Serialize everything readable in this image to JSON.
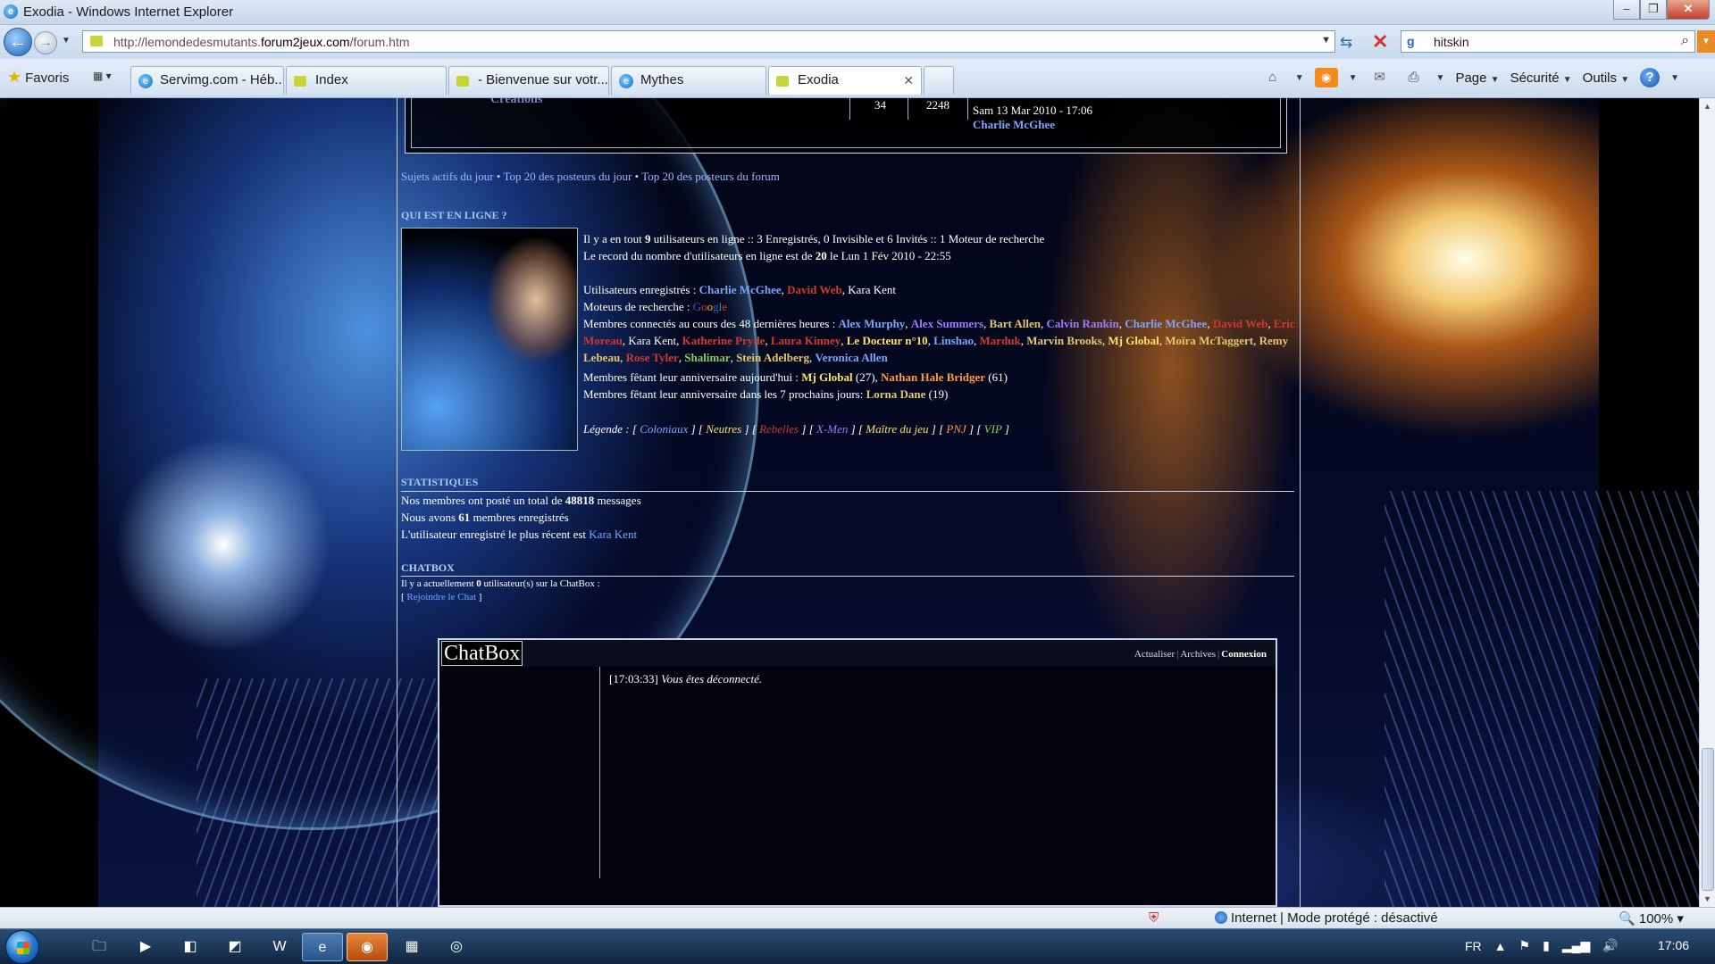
{
  "window": {
    "title": "Exodia - Windows Internet Explorer"
  },
  "nav": {
    "url_prefix": "http://lemondedesmutants.",
    "url_domain": "forum2jeux.com",
    "url_suffix": "/forum.htm",
    "search_value": "hitskin"
  },
  "tabs": {
    "favorites_label": "Favoris",
    "items": [
      {
        "label": "Servimg.com - Héb...",
        "icon": "ie-icon"
      },
      {
        "label": "Index",
        "icon": "forum-icon"
      },
      {
        "label": "- Bienvenue sur votr...",
        "icon": "forum-icon"
      },
      {
        "label": "Mythes",
        "icon": "ie-icon"
      },
      {
        "label": "Exodia",
        "icon": "forum-icon",
        "active": true
      }
    ]
  },
  "commandbar": {
    "page": "Page",
    "security": "Sécurité",
    "tools": "Outils"
  },
  "forum_box": {
    "link": "Créations",
    "topics": "34",
    "posts": "2248",
    "last_date": "Sam 13 Mar 2010 - 17:06",
    "last_author": "Charlie McGhee"
  },
  "active_links": {
    "l1": "Sujets actifs du jour",
    "l2": "Top 20 des posteurs du jour",
    "l3": "Top 20 des posteurs du forum",
    "sep": "•"
  },
  "online": {
    "title": "QUI EST EN LIGNE ?",
    "line1_a": "Il y a en tout ",
    "line1_n": "9",
    "line1_b": " utilisateurs en ligne :: 3 Enregistrés, 0 Invisible et 6 Invités :: 1 Moteur de recherche",
    "line2_a": "Le record du nombre d'utilisateurs en ligne est de ",
    "line2_n": "20",
    "line2_b": " le Lun 1 Fév 2010 - 22:55",
    "registered_label": "Utilisateurs enregistrés : ",
    "reg1": "Charlie McGhee",
    "reg2": "David Web",
    "reg3": "Kara Kent",
    "engines_label": "Moteurs de recherche : ",
    "google": [
      "G",
      "o",
      "o",
      "g",
      "l",
      "e"
    ],
    "recent_label": "Membres connectés au cours des 48 dernières heures : ",
    "recent": [
      {
        "name": "Alex Murphy",
        "cls": "u-blue"
      },
      {
        "name": "Alex Summers",
        "cls": "u-purple"
      },
      {
        "name": "Bart Allen",
        "cls": "u-gold"
      },
      {
        "name": "Calvin Rankin",
        "cls": "u-purple"
      },
      {
        "name": "Charlie McGhee",
        "cls": "u-blue"
      },
      {
        "name": "David Web",
        "cls": "u-red"
      },
      {
        "name": "Eric Moreau",
        "cls": "u-red"
      },
      {
        "name": "Kara Kent",
        "cls": "u-plain"
      },
      {
        "name": "Katherine Pryde",
        "cls": "u-red"
      },
      {
        "name": "Laura Kinney",
        "cls": "u-red"
      },
      {
        "name": "Le Docteur n°10",
        "cls": "u-yellow"
      },
      {
        "name": "Linshao",
        "cls": "u-blue"
      },
      {
        "name": "Marduk",
        "cls": "u-red"
      },
      {
        "name": "Marvin Brooks",
        "cls": "u-gold"
      },
      {
        "name": "Mj Global",
        "cls": "u-yellow"
      },
      {
        "name": "Moïra McTaggert",
        "cls": "u-gold"
      },
      {
        "name": "Remy Lebeau",
        "cls": "u-gold"
      },
      {
        "name": "Rose Tyler",
        "cls": "u-red"
      },
      {
        "name": "Shalimar",
        "cls": "u-green"
      },
      {
        "name": "Stein Adelberg",
        "cls": "u-gold"
      },
      {
        "name": "Veronica Allen",
        "cls": "u-blue"
      }
    ],
    "bday_today_label": "Membres fêtant leur anniversaire aujourd'hui : ",
    "bday_today_1": "Mj Global",
    "bday_today_1_age": " (27), ",
    "bday_today_2": "Nathan Hale Bridger",
    "bday_today_2_age": " (61)",
    "bday_week_label": "Membres fêtant leur anniversaire dans les 7 prochains jours: ",
    "bday_week_1": "Lorna Dane",
    "bday_week_1_age": " (19)",
    "legend_label": "Légende : ",
    "legend": [
      {
        "name": "Coloniaux",
        "color": "#7aa6ff"
      },
      {
        "name": "Neutres",
        "color": "#ffe060"
      },
      {
        "name": "Rebelles",
        "color": "#d03a2f"
      },
      {
        "name": "X-Men",
        "color": "#9c7bff"
      },
      {
        "name": "Maître du jeu",
        "color": "#ffe060"
      },
      {
        "name": "PNJ",
        "color": "#ff9a3c"
      },
      {
        "name": "VIP",
        "color": "#8ac860"
      }
    ]
  },
  "stats": {
    "title": "STATISTIQUES",
    "l1_a": "Nos membres ont posté un total de ",
    "l1_n": "48818",
    "l1_b": " messages",
    "l2_a": "Nous avons ",
    "l2_n": "61",
    "l2_b": " membres enregistrés",
    "l3_a": "L'utilisateur enregistré le plus récent est ",
    "l3_user": "Kara Kent"
  },
  "chatbox": {
    "section_title": "CHATBOX",
    "info_a": "Il y a actuellement ",
    "info_n": "0",
    "info_b": " utilisateur(s) sur la ChatBox :",
    "join": "Rejoindre le Chat",
    "title": "ChatBox",
    "refresh": "Actualiser",
    "archives": "Archives",
    "connect": "Connexion",
    "msg_time": "[17:03:33]",
    "msg_text": "Vous êtes déconnecté."
  },
  "status": {
    "zone": "Internet | Mode protégé : désactivé",
    "zoom": "100%"
  },
  "taskbar": {
    "lang": "FR",
    "time": "17:06"
  }
}
